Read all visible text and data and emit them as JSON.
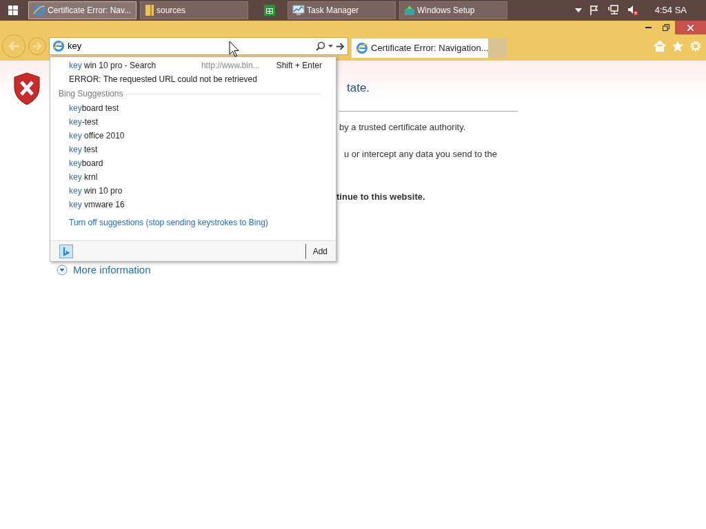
{
  "taskbar": {
    "buttons": [
      {
        "label": "Certificate Error: Nav...",
        "kind": "browser",
        "selected": true
      },
      {
        "label": "sources",
        "kind": "folder",
        "selected": false
      },
      {
        "kind": "store",
        "selected": false
      },
      {
        "label": "Task Manager",
        "kind": "monitor",
        "selected": false
      },
      {
        "label": "Windows Setup",
        "kind": "setup",
        "selected": false
      }
    ],
    "clock": "4:54 SA"
  },
  "address_bar": {
    "value": "key"
  },
  "tabs": [
    {
      "title": "Certificate Error: Navigation...",
      "selected": true
    }
  ],
  "dropdown": {
    "search_row": {
      "match": "key",
      "rest": " win 10 pro - Search",
      "url": "http://www.bin...",
      "shortcut": "Shift + Enter"
    },
    "error": "ERROR: The requested URL could not be retrieved",
    "section_title": "Bing Suggestions",
    "suggestions": [
      {
        "match": "key",
        "rest": "board test"
      },
      {
        "match": "key",
        "rest": "-test"
      },
      {
        "match": "key",
        "rest": " office 2010"
      },
      {
        "match": "key",
        "rest": " test"
      },
      {
        "match": "key",
        "rest": "board"
      },
      {
        "match": "key",
        "rest": " krnl"
      },
      {
        "match": "key",
        "rest": " win 10 pro"
      },
      {
        "match": "key",
        "rest": " vmware 16"
      }
    ],
    "turn_off_link": "Turn off suggestions (stop sending keystrokes to Bing)",
    "add_button": "Add"
  },
  "page": {
    "heading_fragment": "tate.",
    "line_1": "by a trusted certificate authority.",
    "line_2": "u or intercept any data you send to the",
    "bold_line": "tinue to this website.",
    "more_information": "More information"
  }
}
